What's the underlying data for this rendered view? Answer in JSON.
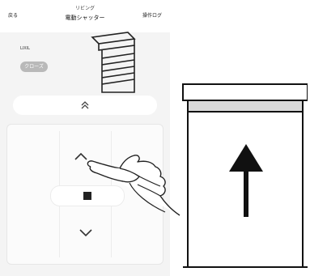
{
  "header": {
    "back_label": "戻る",
    "room": "リビング",
    "device_name": "電動シャッター",
    "log_label": "操作ログ"
  },
  "device": {
    "brand": "LIXIL",
    "status": "クローズ"
  },
  "icons": {
    "shutter": "shutter-icon",
    "double_up": "chevron-double-up-icon",
    "up": "chevron-up-icon",
    "stop": "stop-icon",
    "down": "chevron-down-icon",
    "pointing_hand": "pointing-hand-icon",
    "open_arrow": "arrow-up-icon"
  },
  "colors": {
    "status_badge": "#b9b9b9",
    "app_background": "#f4f4f4"
  }
}
